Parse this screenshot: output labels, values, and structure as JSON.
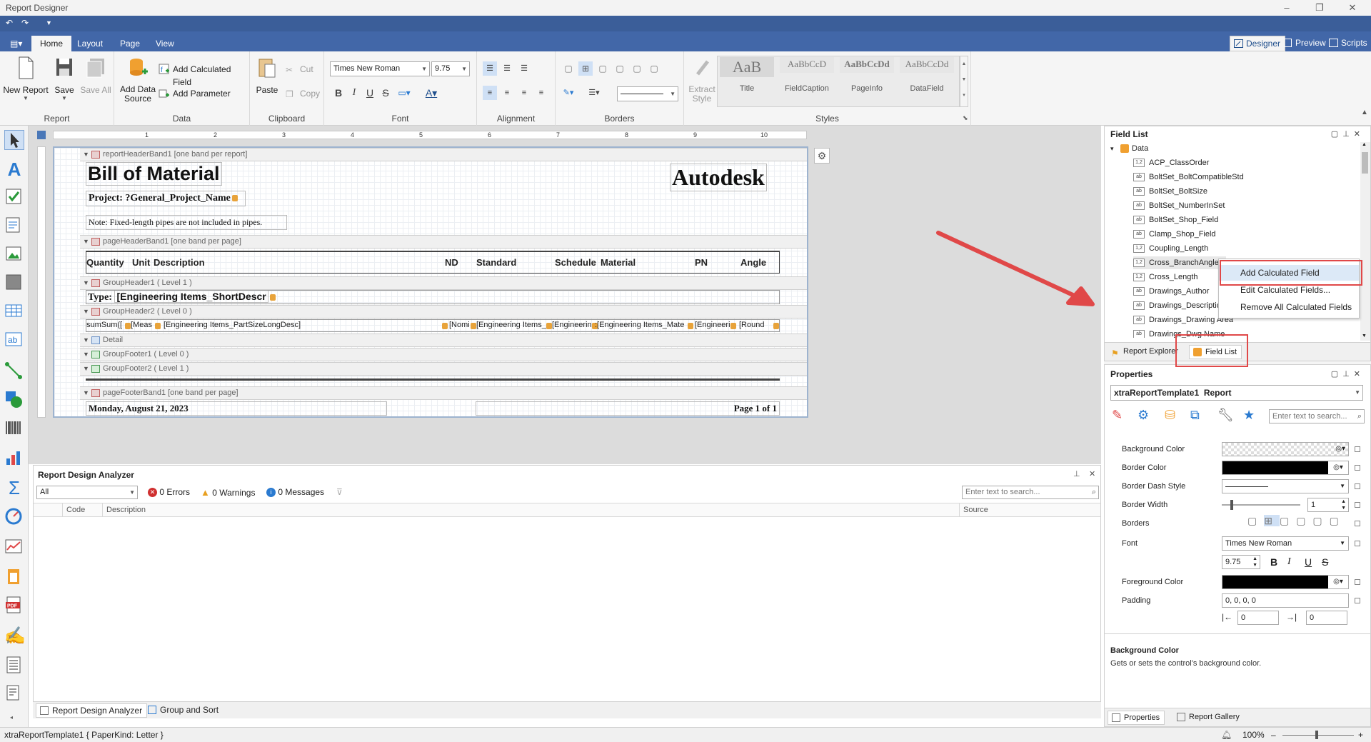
{
  "window": {
    "title": "Report Designer"
  },
  "ribbon": {
    "tabs": [
      "Home",
      "Layout",
      "Page",
      "View"
    ],
    "right_buttons": [
      "Designer",
      "Preview",
      "Scripts"
    ],
    "groups": {
      "report": {
        "label": "Report",
        "new_report": "New Report",
        "save": "Save",
        "save_all": "Save All"
      },
      "data": {
        "label": "Data",
        "add_data_source_1": "Add Data",
        "add_data_source_2": "Source",
        "add_calculated_field": "Add Calculated Field",
        "add_parameter": "Add Parameter"
      },
      "clipboard": {
        "label": "Clipboard",
        "paste": "Paste",
        "cut": "Cut",
        "copy": "Copy"
      },
      "font": {
        "label": "Font",
        "font_name": "Times New Roman",
        "font_size": "9.75"
      },
      "alignment": {
        "label": "Alignment"
      },
      "borders": {
        "label": "Borders"
      },
      "styles": {
        "label": "Styles",
        "extract_1": "Extract",
        "extract_2": "Style",
        "items": [
          {
            "sample": "AaB",
            "name": "Title"
          },
          {
            "sample": "AaBbCcD",
            "name": "FieldCaption"
          },
          {
            "sample": "AaBbCcDd",
            "name": "PageInfo"
          },
          {
            "sample": "AaBbCcDd",
            "name": "DataField"
          }
        ]
      }
    }
  },
  "ruler": {
    "marks": [
      "1",
      "2",
      "3",
      "4",
      "5",
      "6",
      "7",
      "8",
      "9",
      "10"
    ]
  },
  "report": {
    "bands": {
      "report_header": "reportHeaderBand1 [one band per report]",
      "page_header": "pageHeaderBand1 [one band per page]",
      "group_header1": "GroupHeader1 ( Level 1 )",
      "group_header2": "GroupHeader2 ( Level 0 )",
      "detail": "Detail",
      "group_footer1": "GroupFooter1 ( Level 0 )",
      "group_footer2": "GroupFooter2 ( Level 1 )",
      "page_footer": "pageFooterBand1 [one band per page]"
    },
    "title": "Bill of Material",
    "logo_text": "Autodesk",
    "project": "Project: ?General_Project_Name",
    "note": "Note: Fixed-length pipes are not included in pipes.",
    "columns": [
      "Quantity",
      "Unit",
      "Description",
      "ND",
      "Standard",
      "Schedule",
      "Material",
      "PN",
      "Angle"
    ],
    "type_label": "Type:",
    "type_field": "[Engineering Items_ShortDescr",
    "row_fields": [
      "sumSum([",
      "[Meas",
      "[Engineering Items_PartSizeLongDesc]",
      "[Nomi",
      "[Engineering Items_",
      "[Engineerin",
      ":[Engineering Items_Mate",
      "[Engineeri",
      "[Round"
    ],
    "footer_date": "Monday, August 21, 2023",
    "footer_page": "Page 1 of 1"
  },
  "analyzer": {
    "title": "Report Design Analyzer",
    "filter": "All",
    "errors": "0 Errors",
    "warnings": "0 Warnings",
    "messages": "0 Messages",
    "search_placeholder": "Enter text to search...",
    "columns": [
      "Code",
      "Description",
      "Source"
    ],
    "tabs": [
      "Report Design Analyzer",
      "Group and Sort"
    ]
  },
  "field_list": {
    "title": "Field List",
    "root": "Data",
    "items": [
      {
        "type": "1,2",
        "name": "ACP_ClassOrder"
      },
      {
        "type": "ab",
        "name": "BoltSet_BoltCompatibleStd"
      },
      {
        "type": "ab",
        "name": "BoltSet_BoltSize"
      },
      {
        "type": "ab",
        "name": "BoltSet_NumberInSet"
      },
      {
        "type": "ab",
        "name": "BoltSet_Shop_Field"
      },
      {
        "type": "ab",
        "name": "Clamp_Shop_Field"
      },
      {
        "type": "1,2",
        "name": "Coupling_Length"
      },
      {
        "type": "1,2",
        "name": "Cross_BranchAngle1"
      },
      {
        "type": "1,2",
        "name": "Cross_Length"
      },
      {
        "type": "ab",
        "name": "Drawings_Author"
      },
      {
        "type": "ab",
        "name": "Drawings_Description"
      },
      {
        "type": "ab",
        "name": "Drawings_Drawing Area"
      },
      {
        "type": "ab",
        "name": "Drawings_Dwg Name"
      }
    ],
    "tabs": [
      "Report Explorer",
      "Field List"
    ]
  },
  "context_menu": {
    "items": [
      "Add Calculated Field",
      "Edit Calculated Fields...",
      "Remove All Calculated Fields"
    ]
  },
  "properties": {
    "title": "Properties",
    "selected_object": "xtraReportTemplate1",
    "selected_type": "Report",
    "search_placeholder": "Enter text to search...",
    "rows": {
      "background_color": "Background Color",
      "border_color": "Border Color",
      "border_dash_style": "Border Dash Style",
      "border_width": "Border Width",
      "border_width_value": "1",
      "borders": "Borders",
      "font": "Font",
      "font_value": "Times New Roman",
      "font_size": "9.75",
      "foreground_color": "Foreground Color",
      "padding": "Padding",
      "padding_value": "0, 0, 0, 0",
      "padding_left": "0",
      "padding_right": "0"
    },
    "description_title": "Background Color",
    "description_text": "Gets or sets the control's background color.",
    "tabs": [
      "Properties",
      "Report Gallery"
    ]
  },
  "status": {
    "left": "xtraReportTemplate1 { PaperKind: Letter }",
    "zoom": "100%"
  },
  "colors": {
    "accent": "#4267a8",
    "highlight": "#e04848",
    "band_bg": "#f0f0f0"
  }
}
